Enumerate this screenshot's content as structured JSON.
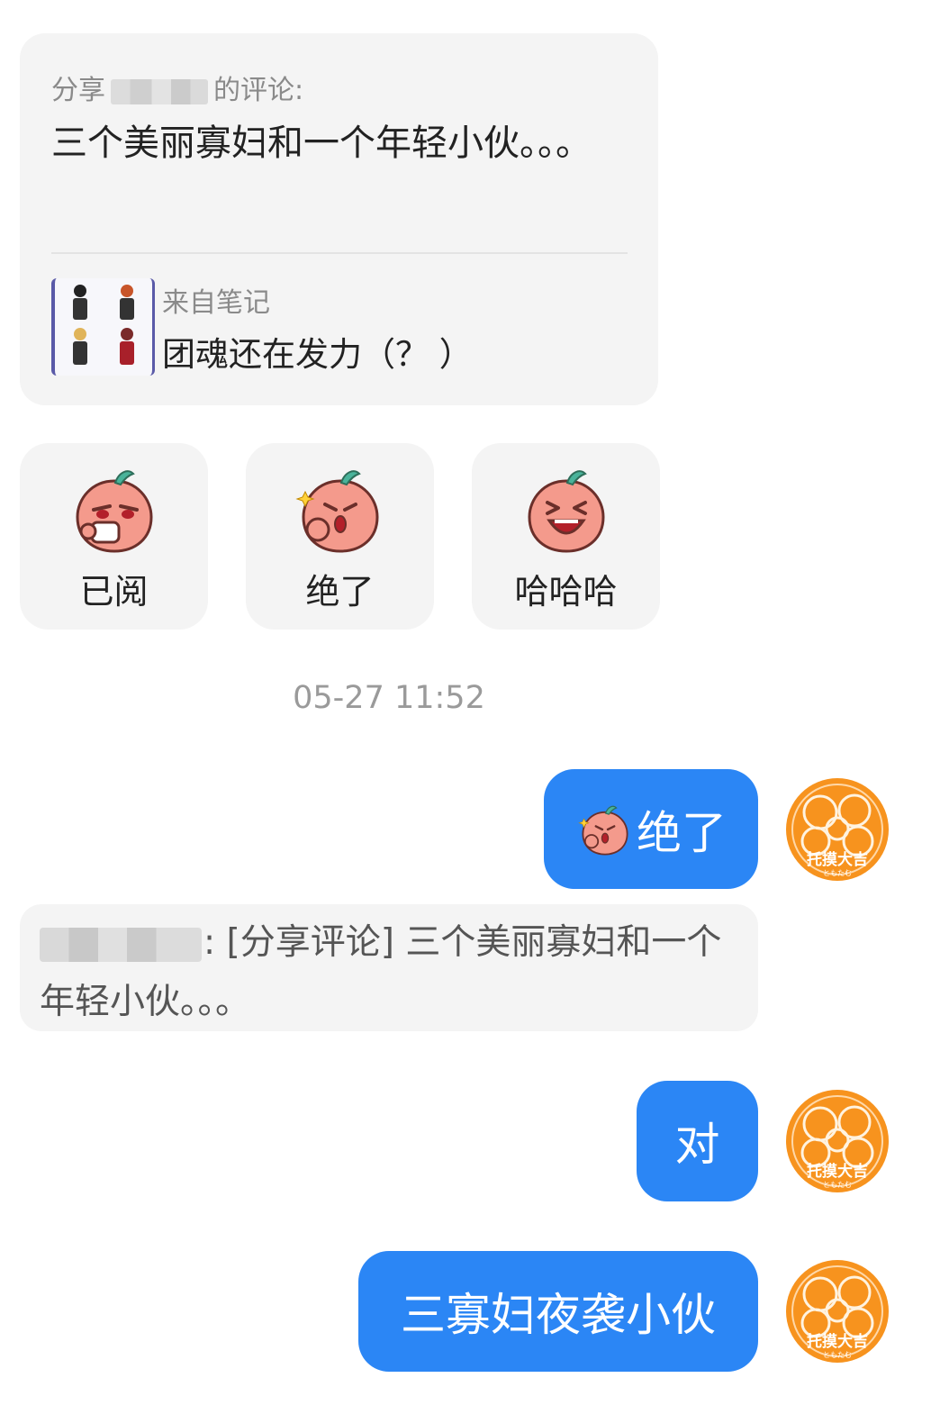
{
  "shared_card": {
    "header_prefix": "分享",
    "header_suffix": "的评论:",
    "comment_text": "三个美丽寡妇和一个年轻小伙。。。",
    "note_source_label": "来自笔记",
    "note_title": "团魂还在发力（？ ）"
  },
  "reactions": [
    {
      "label": "已阅",
      "icon": "peach-sipping-tea-icon"
    },
    {
      "label": "绝了",
      "icon": "peach-thumbs-up-icon"
    },
    {
      "label": "哈哈哈",
      "icon": "peach-laughing-icon"
    }
  ],
  "timestamp": "05-27 11:52",
  "messages": [
    {
      "text": "绝了",
      "icon": "peach-thumbs-up-icon"
    },
    {
      "text": "对"
    },
    {
      "text": "三寡妇夜袭小伙"
    }
  ],
  "quote": {
    "text": ": [分享评论] 三个美丽寡妇和一个年轻小伙。。。"
  },
  "avatar": {
    "icon": "avatar-icon",
    "text": "托摸大吉",
    "subtext": "ともたむ"
  },
  "colors": {
    "bubble_blue": "#2b86f5",
    "card_bg": "#f4f4f4",
    "avatar_orange": "#f7931e"
  }
}
